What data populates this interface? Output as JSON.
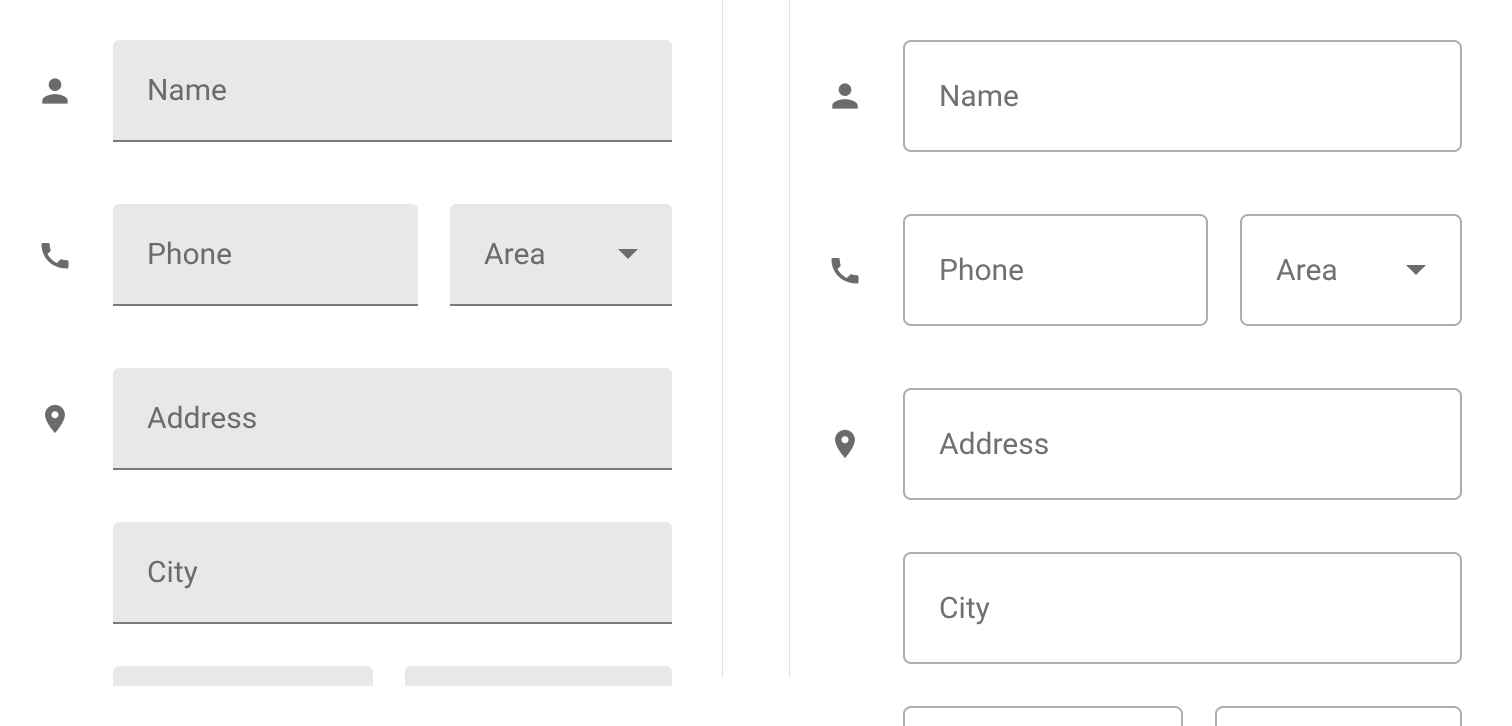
{
  "left_form": {
    "style": "filled",
    "rows": [
      {
        "icon": "person",
        "fields": [
          {
            "label": "Name",
            "type": "text"
          }
        ]
      },
      {
        "icon": "phone",
        "fields": [
          {
            "label": "Phone",
            "type": "text"
          },
          {
            "label": "Area",
            "type": "select"
          }
        ]
      },
      {
        "icon": "location",
        "fields": [
          {
            "label": "Address",
            "type": "text"
          }
        ]
      },
      {
        "icon": null,
        "fields": [
          {
            "label": "City",
            "type": "text"
          }
        ]
      }
    ]
  },
  "right_form": {
    "style": "outlined",
    "rows": [
      {
        "icon": "person",
        "fields": [
          {
            "label": "Name",
            "type": "text"
          }
        ]
      },
      {
        "icon": "phone",
        "fields": [
          {
            "label": "Phone",
            "type": "text"
          },
          {
            "label": "Area",
            "type": "select"
          }
        ]
      },
      {
        "icon": "location",
        "fields": [
          {
            "label": "Address",
            "type": "text"
          }
        ]
      },
      {
        "icon": null,
        "fields": [
          {
            "label": "City",
            "type": "text"
          }
        ]
      }
    ]
  }
}
